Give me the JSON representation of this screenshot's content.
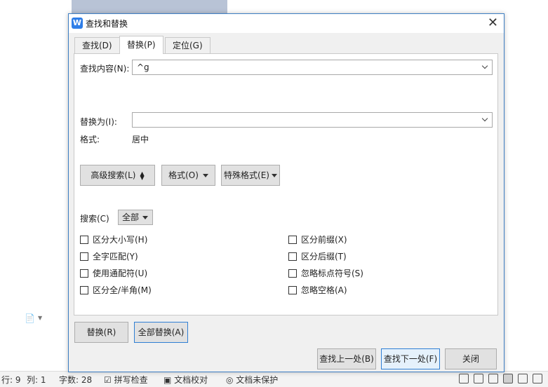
{
  "status_bar": {
    "row": "行: 9",
    "col": "列: 1",
    "word_count": "字数: 28",
    "spell_check": "拼写检查",
    "doc_proof": "文档校对",
    "doc_protect": "文档未保护"
  },
  "dialog": {
    "title": "查找和替换",
    "tabs": [
      {
        "label": "查找(D)"
      },
      {
        "label": "替换(P)"
      },
      {
        "label": "定位(G)"
      }
    ],
    "active_tab": "替换(P)",
    "find_label": "查找内容(N):",
    "find_value": "^g",
    "replace_label": "替换为(I):",
    "replace_value": "",
    "format_label": "格式:",
    "format_value": "居中",
    "buttons": {
      "advanced": "高级搜索(L)",
      "format": "格式(O)",
      "special": "特殊格式(E)"
    },
    "search_label": "搜索(C)",
    "search_scope": "全部",
    "options_left": [
      "区分大小写(H)",
      "全字匹配(Y)",
      "使用通配符(U)",
      "区分全/半角(M)"
    ],
    "options_right": [
      "区分前缀(X)",
      "区分后缀(T)",
      "忽略标点符号(S)",
      "忽略空格(A)"
    ],
    "replace_button": "替换(R)",
    "replace_all_button": "全部替换(A)",
    "find_prev_button": "查找上一处(B)",
    "find_next_button": "查找下一处(F)",
    "close_button": "关闭"
  },
  "icons": {
    "app": "wps-writer-icon",
    "close": "close-icon"
  },
  "colors": {
    "accent": "#2f7fd4",
    "dialog_bg": "#f0f0f0",
    "app_icon": "#2f7ee8"
  }
}
